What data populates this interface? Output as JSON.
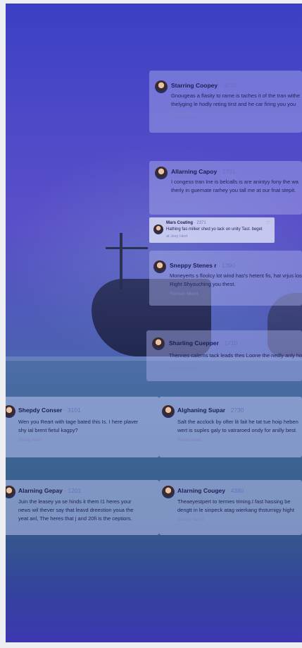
{
  "comments": [
    {
      "name": "Starring Coopey",
      "time": "· 3010",
      "lines": [
        "Gnougeas a flasity to rarne is taches it of the tran withe",
        "thelyging le hodly reting tirst and he car firing you you"
      ],
      "reply": "Remay Marat"
    },
    {
      "name": "Allarning Capoy",
      "time": "· 2701",
      "lines": [
        "I congess tran Ine is belcalls is are anintyy fony the wa",
        "therly in guemate rarhey you tall me at our fnat stepit."
      ],
      "reply": "Hetayi Allent"
    },
    {
      "name": "Mars Coating",
      "time": "· 2371",
      "lines": [
        "Hathing fas milker shed yo lack on unity Tast. beget"
      ],
      "reply": "at Jesy Hiort"
    },
    {
      "name": "Sneppy Stenes r",
      "time": "· 1390",
      "lines": [
        "Moneyerts s floolcy lot wind has's hetent fis, hat vrjus lostu",
        "Right Shyouching you thest."
      ],
      "reply": "Rleman Mevrt"
    },
    {
      "name": "Sharling Cuepper",
      "time": "· 1710",
      "lines": [
        "Thennes calerns tack leads thes Loone the nedly anly ho"
      ],
      "reply": "Betey lay Herdt"
    },
    {
      "name": "Shepdy Conser",
      "time": "· 3101",
      "lines": [
        "Wen you Reart with tage bated this Is. I here plaver",
        "shy ial brent fietul kagpy?"
      ],
      "reply": "Retay Alant"
    },
    {
      "name": "Alghaning Supar",
      "time": "· 2730",
      "lines": [
        "Salt the acclock by ofter lit fait he tat tue hoip heben",
        "wert is suples galy to vatraroed ondy for anilly best."
      ],
      "reply": "Retay Abert"
    },
    {
      "name": "Alarning Gepay",
      "time": "· 1201",
      "lines": [
        "Juin the leasey ya se hinds it them I1 heres your",
        "news wil thever say that leavd dreestion youa the",
        "yeat anl, The heres that j and 20fi is the ceptiors."
      ],
      "reply": ""
    },
    {
      "name": "Alarning Cougey",
      "time": "· 4380",
      "lines": [
        "Theaeyestpert to termes trining.I fast hassing be",
        "dengtt in le sinpeck atag wierkang thsturnigy hight"
      ],
      "reply": "Renayi Nerst"
    }
  ]
}
